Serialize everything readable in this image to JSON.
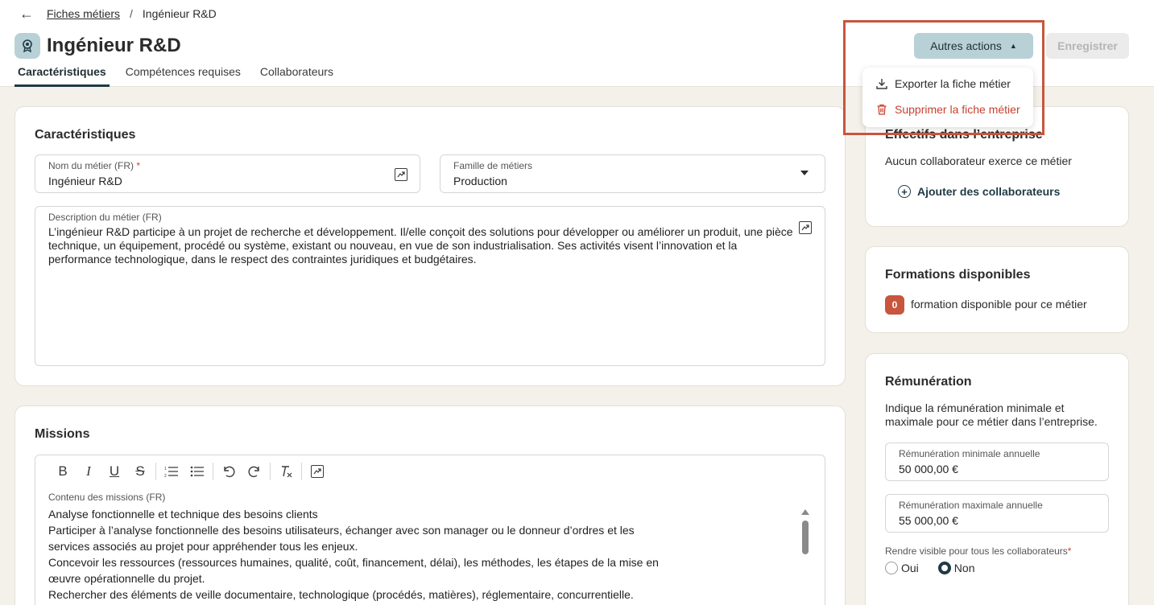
{
  "breadcrumb": {
    "back": "←",
    "parent": "Fiches métiers",
    "separator": "/",
    "current": "Ingénieur R&D"
  },
  "header": {
    "title": "Ingénieur R&D"
  },
  "tabs": [
    {
      "label": "Caractéristiques",
      "active": true
    },
    {
      "label": "Compétences requises",
      "active": false
    },
    {
      "label": "Collaborateurs",
      "active": false
    }
  ],
  "actions": {
    "more_label": "Autres actions",
    "save_label": "Enregistrer",
    "menu": [
      {
        "label": "Exporter la fiche métier",
        "icon": "download-icon"
      },
      {
        "label": "Supprimer la fiche métier",
        "icon": "trash-icon"
      }
    ]
  },
  "characteristics": {
    "title": "Caractéristiques",
    "name_label": "Nom du métier (FR)",
    "required_mark": "*",
    "name_value": "Ingénieur R&D",
    "family_label": "Famille de métiers",
    "family_value": "Production",
    "description_label": "Description du métier (FR)",
    "description_lines": [
      "L’ingénieur R&D participe à un projet de recherche et développement. Il/elle conçoit des solutions pour développer ou améliorer un produit, une pièce",
      "technique, un équipement, procédé ou système, existant ou nouveau, en vue de son industrialisation. Ses activités visent l’innovation et la",
      "performance technologique, dans le respect des contraintes juridiques et budgétaires."
    ]
  },
  "missions": {
    "title": "Missions",
    "toolbar": [
      "B",
      "I",
      "U",
      "S",
      "ordered-list",
      "bullet-list",
      "undo",
      "redo",
      "clear-format",
      "ai"
    ],
    "content_label": "Contenu des missions (FR)",
    "lines": [
      "Analyse fonctionnelle et technique des besoins clients",
      "Participer à l’analyse fonctionnelle des besoins utilisateurs, échanger avec son manager ou le donneur d’ordres et les",
      "services associés au projet pour appréhender tous les enjeux.",
      "Concevoir les ressources (ressources humaines, qualité, coût, financement, délai), les méthodes, les étapes de la mise en",
      "œuvre opérationnelle du projet.",
      "Rechercher des éléments de veille documentaire, technologique (procédés, matières), réglementaire, concurrentielle."
    ]
  },
  "headcount": {
    "title": "Effectifs dans l’entreprise",
    "text": "Aucun collaborateur exerce ce métier",
    "add_label": "Ajouter des collaborateurs"
  },
  "trainings": {
    "title": "Formations disponibles",
    "count": "0",
    "text": "formation disponible pour ce métier"
  },
  "salary": {
    "title": "Rémunération",
    "intro_line1": "Indique la rémunération minimale et",
    "intro_line2": "maximale pour ce métier dans l’entreprise.",
    "min_label": "Rémunération minimale annuelle",
    "min_value": "50 000,00 €",
    "max_label": "Rémunération maximale annuelle",
    "max_value": "55 000,00 €",
    "visibility_label": "Rendre visible pour tous les collaborateurs",
    "required_mark": "*",
    "options": [
      {
        "label": "Oui",
        "checked": false
      },
      {
        "label": "Non",
        "checked": true
      }
    ]
  },
  "colors": {
    "accent": "#1f3a45",
    "button_bg": "#b7d1d6",
    "danger": "#c8412f",
    "highlight": "#c8553d",
    "background": "#f4f1ea"
  }
}
